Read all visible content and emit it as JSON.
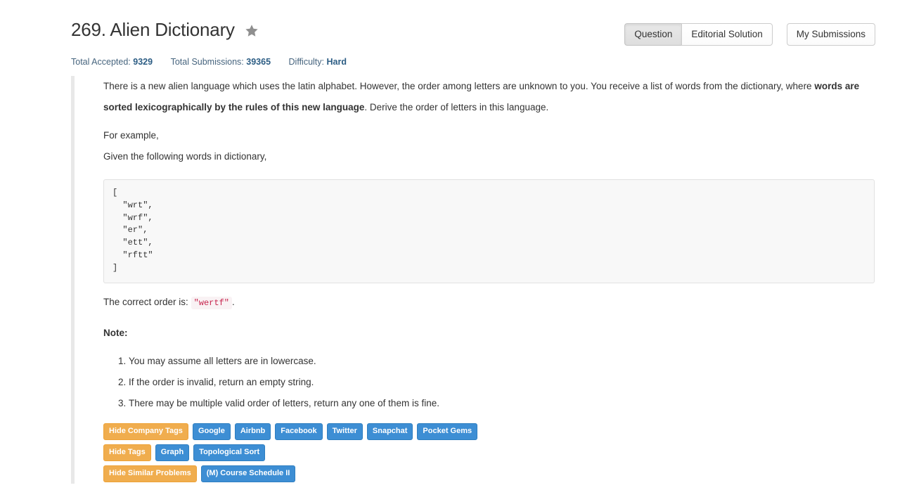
{
  "header": {
    "title": "269. Alien Dictionary",
    "star_icon": "star-icon",
    "stats": [
      {
        "label": "Total Accepted:",
        "value": "9329"
      },
      {
        "label": "Total Submissions:",
        "value": "39365"
      },
      {
        "label": "Difficulty:",
        "value": "Hard"
      }
    ],
    "buttons": {
      "question": "Question",
      "editorial_solution": "Editorial Solution",
      "my_submissions": "My Submissions"
    }
  },
  "question": {
    "intro_part1": "There is a new alien language which uses the latin alphabet. However, the order among letters are unknown to you. You receive a list of words from the dictionary, where ",
    "intro_bold": "words are sorted lexicographically by the rules of this new language",
    "intro_part2": ". Derive the order of letters in this language.",
    "for_example": "For example,",
    "given_words": "Given the following words in dictionary,",
    "code_block": "[\n  \"wrt\",\n  \"wrf\",\n  \"er\",\n  \"ett\",\n  \"rftt\"\n]",
    "order_prefix": "The correct order is:",
    "order_code": "\"wertf\"",
    "order_suffix": ".",
    "note_heading": "Note:",
    "notes": [
      "You may assume all letters are in lowercase.",
      "If the order is invalid, return an empty string.",
      "There may be multiple valid order of letters, return any one of them is fine."
    ]
  },
  "tags": {
    "company_row": {
      "toggle": "Hide Company Tags",
      "items": [
        "Google",
        "Airbnb",
        "Facebook",
        "Twitter",
        "Snapchat",
        "Pocket Gems"
      ]
    },
    "topic_row": {
      "toggle": "Hide Tags",
      "items": [
        "Graph",
        "Topological Sort"
      ]
    },
    "similar_row": {
      "toggle": "Hide Similar Problems",
      "items": [
        "(M) Course Schedule II"
      ]
    }
  },
  "colors": {
    "warning": "#f0ad4e",
    "primary": "#3d8ed4",
    "stat_link": "#46647e",
    "inline_code": "#c7254e",
    "inline_code_bg": "#f9f2f4"
  }
}
